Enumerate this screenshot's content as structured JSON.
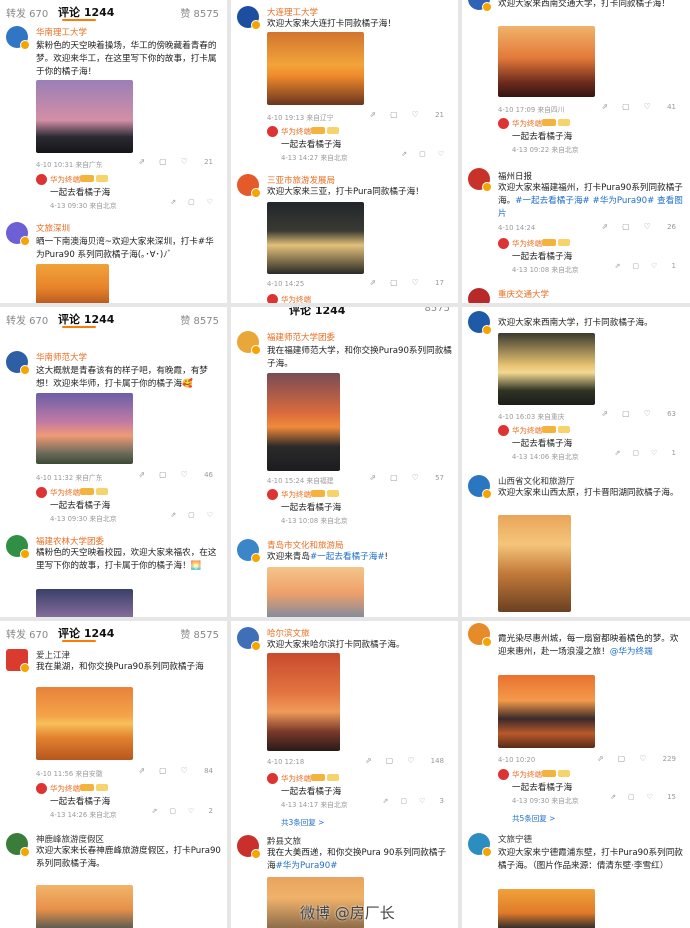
{
  "header": {
    "repost": "转发 670",
    "comments": "评论 1244",
    "likes": "赞 8575"
  },
  "header_right_partial": "8575",
  "reply_author": "华为终端",
  "reply_text": "一起去看橘子海",
  "p1": {
    "c1": {
      "name": "华南理工大学",
      "text": "紫粉色的天空映着操场，华工的傍晚藏着青春的梦。欢迎来华工，在这里写下你的故事，打卡属于你的橘子海！",
      "meta": "4-10 10:31 来自广东",
      "likes": "21",
      "reply_meta": "4-13 09:30 来自北京"
    },
    "c2": {
      "name": "文旅深圳",
      "text": "晒一下南澳海贝湾~欢迎大家来深圳，打卡#华为Pura90 系列同款橘子海(｡･∀･)ﾉﾞ"
    }
  },
  "p2": {
    "c1": {
      "name": "大连理工大学",
      "text": "欢迎大家来大连打卡同款橘子海！",
      "meta": "4-10 19:13 来自辽宁",
      "likes": "21",
      "reply_meta": "4-13 14:27 来自北京"
    },
    "c2": {
      "name": "三亚市旅游发展局",
      "text": "欢迎大家来三亚，打卡Pura同款橘子海！",
      "meta": "4-10 14:25",
      "likes": "17"
    },
    "c3_name": "华为终端"
  },
  "p3": {
    "c0": {
      "text": "欢迎大家来西南交通大学，打卡同款橘子海！",
      "meta": "4-10 17:09 来自四川",
      "likes": "41",
      "reply_meta": "4-13 09:22 来自北京"
    },
    "c1": {
      "name": "福州日报",
      "text_a": "欢迎大家来福建福州，打卡Pura90系列同款橘子海。",
      "hashtags": "#一起去看橘子海# #华为Pura90#",
      "view_pic": "查看图片",
      "meta": "4-10 14:24",
      "likes": "26",
      "reply_meta": "4-13 10:08 来自北京",
      "reply_likes": "1"
    },
    "c2_name": "重庆交通大学"
  },
  "p4": {
    "c1": {
      "name": "华南师范大学",
      "text": "这大概就是青春该有的样子吧，有晚霞，有梦想！欢迎来华师，打卡属于你的橘子海🥰",
      "meta": "4-10 11:32 来自广东",
      "likes": "46",
      "reply_meta": "4-13 09:30 来自北京"
    },
    "c2": {
      "name": "福建农林大学团委",
      "text": "橘粉色的天空映着校园，欢迎大家来福农，在这里写下你的故事，打卡属于你的橘子海！🌅"
    }
  },
  "p5": {
    "c1": {
      "name": "福建师范大学团委",
      "text": "我在福建师范大学，和你交换Pura90系列同款橘子海。",
      "meta": "4-10 15:24 来自福建",
      "likes": "57",
      "reply_meta": "4-13 10:08 来自北京"
    },
    "c2": {
      "name": "青岛市文化和旅游局",
      "text_a": "欢迎来青岛",
      "hashtag": "#一起去看橘子海#",
      "text_b": "!"
    }
  },
  "p6": {
    "c0": {
      "text": "欢迎大家来西南大学，打卡同款橘子海。",
      "meta": "4-10 16:03 来自重庆",
      "likes": "63",
      "reply_meta": "4-13 14:06 来自北京",
      "reply_likes": "1"
    },
    "c1": {
      "name": "山西省文化和旅游厅",
      "text": "欢迎大家来山西太原，打卡晋阳湖同款橘子海。"
    }
  },
  "p7": {
    "c1": {
      "name": "爱上江津",
      "text": "我在巢湖，和你交换Pura90系列同款橘子海",
      "meta": "4-10 11:56 来自安徽",
      "likes": "84",
      "reply_meta": "4-13 14:26 来自北京",
      "reply_likes": "2"
    },
    "c2": {
      "name": "神鹿峰旅游度假区",
      "text": "欢迎大家来长春神鹿峰旅游度假区，打卡Pura90系列同款橘子海。"
    }
  },
  "p8": {
    "c1": {
      "name": "哈尔滨文旅",
      "text": "欢迎大家来哈尔滨打卡同款橘子海。",
      "meta": "4-10 12:18",
      "likes": "148",
      "reply_meta": "4-13 14:17 来自北京",
      "reply_likes": "3",
      "more": "共3条回复 >"
    },
    "c2": {
      "name": "黔县文旅",
      "text_a": "我在大美西递，和你交换Pura 90系列同款橘子海",
      "hashtag": "#华为Pura90#"
    }
  },
  "p9": {
    "c0": {
      "text_a": "霞光染尽惠州城，每一扇窗都映着橘色的梦。欢迎来惠州，赴一场浪漫之旅！",
      "mention": "@华为终端",
      "meta": "4-10 10:20",
      "likes": "229",
      "reply_meta": "4-13 09:30 来自北京",
      "reply_likes": "15",
      "more": "共5条回复 >"
    },
    "c1": {
      "name": "文旅宁德",
      "text": "欢迎大家来宁德霞浦东壁，打卡Pura90系列同款橘子海。（图片作品来源：倩清东壁·李雪红）"
    }
  },
  "watermark": "微博 @房厂长",
  "colors": {
    "accent": "#ff7a00",
    "name": "#ea6d1f",
    "link": "#1e6ec8"
  }
}
